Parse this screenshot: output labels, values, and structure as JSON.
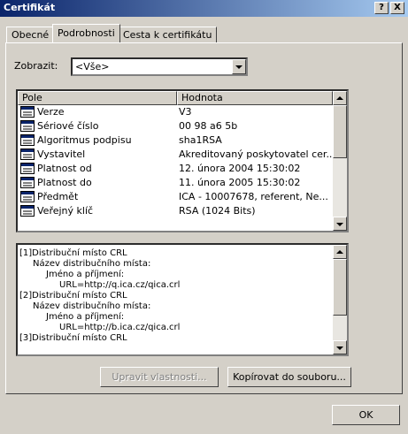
{
  "window": {
    "title": "Certifikát",
    "help_label": "?",
    "close_label": "X"
  },
  "tabs": [
    {
      "label": "Obecné"
    },
    {
      "label": "Podrobnosti"
    },
    {
      "label": "Cesta k certifikátu"
    }
  ],
  "show": {
    "label": "Zobrazit:",
    "value": "<Vše>"
  },
  "list": {
    "columns": [
      "Pole",
      "Hodnota"
    ],
    "rows": [
      {
        "field": "Verze",
        "value": "V3"
      },
      {
        "field": "Sériové číslo",
        "value": "00 98 a6 5b"
      },
      {
        "field": "Algoritmus podpisu",
        "value": "sha1RSA"
      },
      {
        "field": "Vystavitel",
        "value": "Akreditovaný poskytovatel cer..."
      },
      {
        "field": "Platnost od",
        "value": "12. února 2004 15:30:02"
      },
      {
        "field": "Platnost do",
        "value": "11. února 2005 15:30:02"
      },
      {
        "field": "Předmět",
        "value": "ICA - 10007678, referent, Ne..."
      },
      {
        "field": "Veřejný klíč",
        "value": "RSA (1024 Bits)"
      }
    ]
  },
  "details": {
    "lines": [
      "[1]Distribuční místo CRL",
      "Název distribučního místa:",
      "Jméno a příjmení:",
      "URL=http://q.ica.cz/qica.crl",
      "[2]Distribuční místo CRL",
      "Název distribučního místa:",
      "Jméno a příjmení:",
      "URL=http://b.ica.cz/qica.crl",
      "[3]Distribuční místo CRL"
    ]
  },
  "buttons": {
    "edit": "Upravit vlastnosti...",
    "copy": "Kopírovat do souboru...",
    "ok": "OK"
  },
  "icons": {
    "field_icon": "certificate-field-icon"
  },
  "colors": {
    "title_start": "#0a246a",
    "title_end": "#a6caf0",
    "face": "#d4d0c8"
  }
}
